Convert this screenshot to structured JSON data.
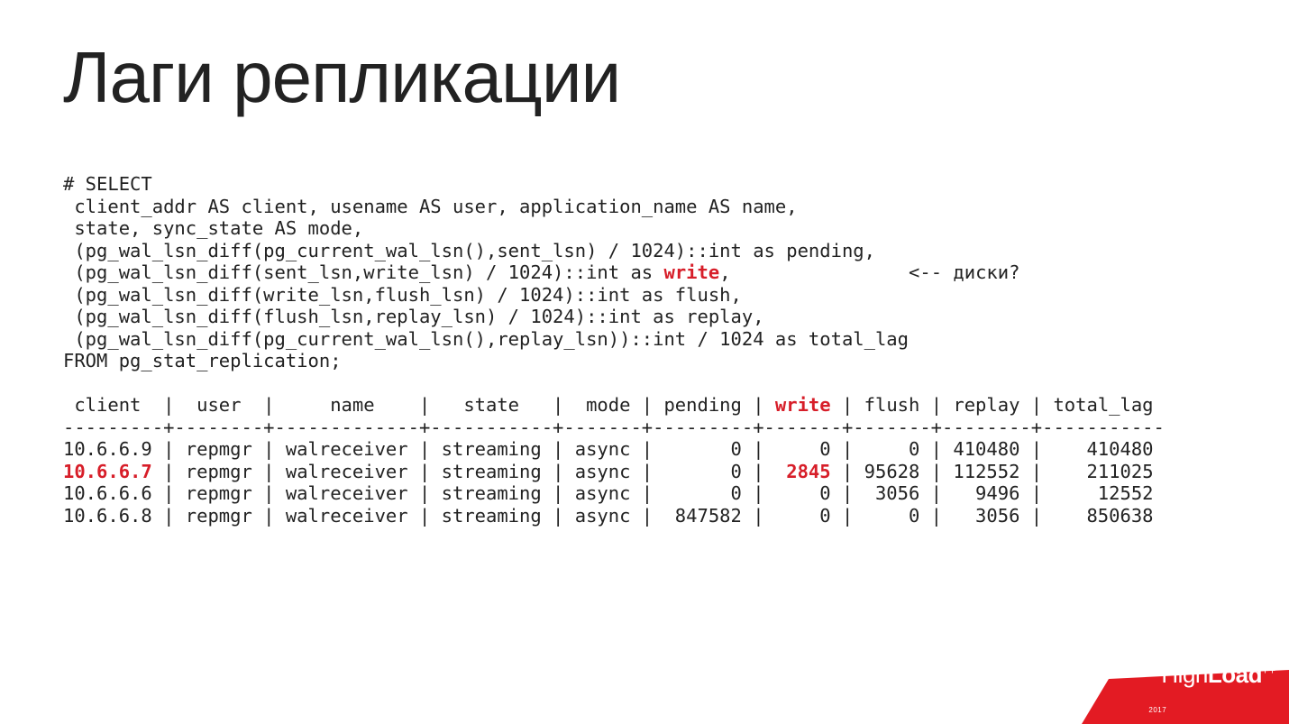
{
  "title": "Лаги репликации",
  "sql": {
    "l1": "# SELECT",
    "l2": " client_addr AS client, usename AS user, application_name AS name,",
    "l3": " state, sync_state AS mode,",
    "l4": " (pg_wal_lsn_diff(pg_current_wal_lsn(),sent_lsn) / 1024)::int as pending,",
    "l5a": " (pg_wal_lsn_diff(sent_lsn,write_lsn) / 1024)::int as ",
    "l5_write": "write",
    "l5b": ",                <-- диски?",
    "l6": " (pg_wal_lsn_diff(write_lsn,flush_lsn) / 1024)::int as flush,",
    "l7": " (pg_wal_lsn_diff(flush_lsn,replay_lsn) / 1024)::int as replay,",
    "l8": " (pg_wal_lsn_diff(pg_current_wal_lsn(),replay_lsn))::int / 1024 as total_lag",
    "l9": "FROM pg_stat_replication;"
  },
  "table": {
    "hdr_a": " client  |  user  |     name    |   state   |  mode | pending | ",
    "hdr_write": "write",
    "hdr_b": " | flush | replay | total_lag",
    "sep": "---------+--------+-------------+-----------+-------+---------+-------+-------+--------+-----------",
    "r1": "10.6.6.9 | repmgr | walreceiver | streaming | async |       0 |     0 |     0 | 410480 |    410480",
    "r2_client": "10.6.6.7",
    "r2_a": " | repmgr | walreceiver | streaming | async |       0 |  ",
    "r2_write": "2845",
    "r2_b": " | 95628 | 112552 |    211025",
    "r3": "10.6.6.6 | repmgr | walreceiver | streaming | async |       0 |     0 |  3056 |   9496 |     12552",
    "r4": "10.6.6.8 | repmgr | walreceiver | streaming | async |  847582 |     0 |     0 |   3056 |    850638"
  },
  "logo": {
    "thin": "High",
    "bold": "Load",
    "plus": "++",
    "year": "2017"
  },
  "colors": {
    "accent": "#e31b23"
  }
}
